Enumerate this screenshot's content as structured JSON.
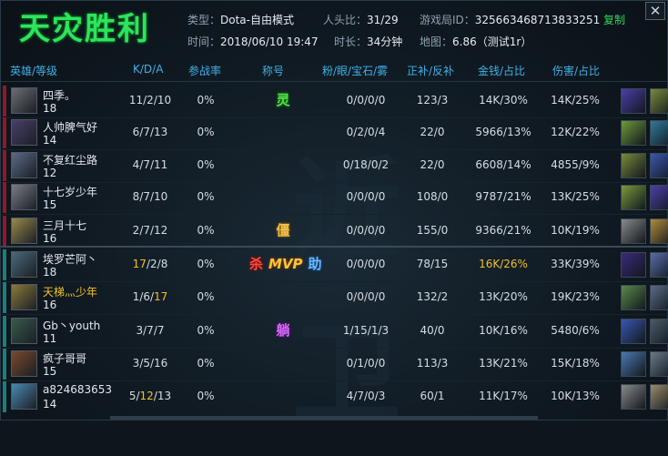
{
  "header": {
    "result": "天灾胜利",
    "type_label": "类型：",
    "type_value": "Dota-自由模式",
    "kills_label": "人头比：",
    "kills_value": "31/29",
    "game_id_label": "游戏局ID：",
    "game_id_value": "325663468713833251",
    "copy_label": "复制",
    "time_label": "时间：",
    "time_value": "2018/06/10 19:47",
    "duration_label": "时长：",
    "duration_value": "34分钟",
    "map_label": "地图：",
    "map_value": "6.86（测试1r）",
    "close_label": "✕"
  },
  "columns": {
    "hero": "英雄/等级",
    "kda": "K/D/A",
    "participation": "参战率",
    "title": "称号",
    "wards": "粉/眼/宝石/雾",
    "cs": "正补/反补",
    "gold": "金钱/占比",
    "damage": "伤害/占比"
  },
  "watermark": "近卫",
  "colors": {
    "win_green": "#2fe35a",
    "header_blue": "#3fb0e8",
    "highlight_gold": "#f2c02a",
    "radiant_bar": "#8a1a2a",
    "dire_bar": "#1e7d7a"
  },
  "players": [
    {
      "name": "四季。",
      "level": "18",
      "kda": "11/2/10",
      "part": "0%",
      "titles": [
        {
          "text": "灵",
          "style": "b-ling"
        }
      ],
      "wards": "0/0/0/0",
      "cs": "123/3",
      "gold": "14K/30%",
      "damage": "14K/25%",
      "hero_color": "#6b6f74",
      "items": [
        "#4b3fa8",
        "#7a8a3a"
      ]
    },
    {
      "name": "人帅脾气好",
      "level": "14",
      "kda": "6/7/13",
      "part": "0%",
      "titles": [],
      "wards": "0/2/0/4",
      "cs": "22/0",
      "gold": "5966/13%",
      "damage": "12K/22%",
      "hero_color": "#4a3f6a",
      "items": [
        "#6f9a3a",
        "#2f7a9a"
      ]
    },
    {
      "name": "不复红尘路",
      "level": "12",
      "kda": "4/7/11",
      "part": "0%",
      "titles": [],
      "wards": "0/18/0/2",
      "cs": "22/0",
      "gold": "6608/14%",
      "damage": "4855/9%",
      "hero_color": "#5a6a86",
      "items": [
        "#7a8a3a",
        "#3a56b0"
      ]
    },
    {
      "name": "十七岁少年",
      "level": "15",
      "kda": "8/7/10",
      "part": "0%",
      "titles": [],
      "wards": "0/0/0/0",
      "cs": "108/0",
      "gold": "9787/21%",
      "damage": "13K/25%",
      "hero_color": "#7a7e84",
      "items": [
        "#7a9a3a",
        "#4b3fa8"
      ]
    },
    {
      "name": "三月十七",
      "level": "16",
      "kda": "2/7/12",
      "part": "0%",
      "titles": [
        {
          "text": "僵",
          "style": "b-jiang"
        }
      ],
      "wards": "0/0/0/0",
      "cs": "155/0",
      "gold": "9366/21%",
      "damage": "10K/19%",
      "hero_color": "#9a8a4a",
      "items": [
        "#8a8a8a",
        "#b08a3a"
      ]
    },
    {
      "name": "埃罗芒阿丶",
      "level": "18",
      "kda": "17/2/8",
      "kda_hl": "17",
      "part": "0%",
      "titles": [
        {
          "text": "杀",
          "style": "b-sha"
        },
        {
          "text": "MVP",
          "style": "b-mvp"
        },
        {
          "text": "助",
          "style": "b-zhu"
        }
      ],
      "wards": "0/0/0/0",
      "cs": "78/15",
      "gold": "16K/26%",
      "gold_hl": true,
      "damage": "33K/39%",
      "hero_color": "#4a6a7a",
      "items": [
        "#3a2a7a",
        "#5a6aa8"
      ]
    },
    {
      "name": "天梯灬少年",
      "name_hl": true,
      "level": "16",
      "kda": "1/6/17",
      "kda_hl_tail": "17",
      "part": "0%",
      "titles": [],
      "wards": "0/0/0/0",
      "cs": "132/2",
      "gold": "13K/20%",
      "damage": "19K/23%",
      "hero_color": "#8a7a3a",
      "items": [
        "#5a8a4a",
        "#5a6a86"
      ]
    },
    {
      "name": "Gb丶youth",
      "level": "11",
      "kda": "3/7/7",
      "part": "0%",
      "titles": [
        {
          "text": "躺",
          "style": "b-tang"
        }
      ],
      "wards": "1/15/1/3",
      "cs": "40/0",
      "gold": "10K/16%",
      "damage": "5480/6%",
      "hero_color": "#3a5a4a",
      "items": [
        "#3a56b0",
        "#4a5a6a"
      ]
    },
    {
      "name": "疯子哥哥",
      "level": "15",
      "kda": "3/5/16",
      "part": "0%",
      "titles": [],
      "wards": "0/1/0/0",
      "cs": "113/3",
      "gold": "13K/21%",
      "damage": "15K/18%",
      "hero_color": "#7a4a2a",
      "items": [
        "#4a7ab0",
        "#6a7a8a"
      ]
    },
    {
      "name": "a824683653",
      "level": "14",
      "kda": "5/12/13",
      "kda_hl_mid": "12",
      "part": "0%",
      "titles": [],
      "wards": "4/7/0/3",
      "cs": "60/1",
      "gold": "11K/17%",
      "damage": "10K/13%",
      "hero_color": "#4a8ab0",
      "items": [
        "#8a8a8a",
        "#9a8a6a"
      ]
    }
  ]
}
